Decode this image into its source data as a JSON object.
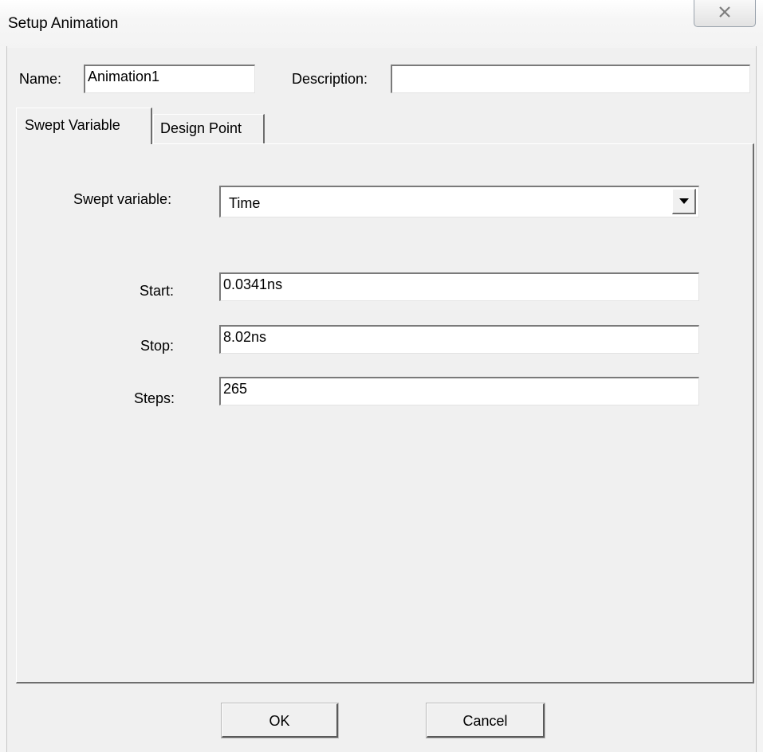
{
  "window": {
    "title": "Setup Animation"
  },
  "form": {
    "name_label": "Name:",
    "name_value": "Animation1",
    "description_label": "Description:",
    "description_value": ""
  },
  "tabs": [
    {
      "label": "Swept Variable",
      "active": true
    },
    {
      "label": "Design Point",
      "active": false
    }
  ],
  "swept": {
    "variable_label": "Swept variable:",
    "variable_value": "Time",
    "start_label": "Start:",
    "start_value": "0.0341ns",
    "stop_label": "Stop:",
    "stop_value": "8.02ns",
    "steps_label": "Steps:",
    "steps_value": "265"
  },
  "buttons": {
    "ok_label": "OK",
    "cancel_label": "Cancel"
  },
  "icons": {
    "close": "close-icon",
    "dropdown": "chevron-down-icon"
  }
}
